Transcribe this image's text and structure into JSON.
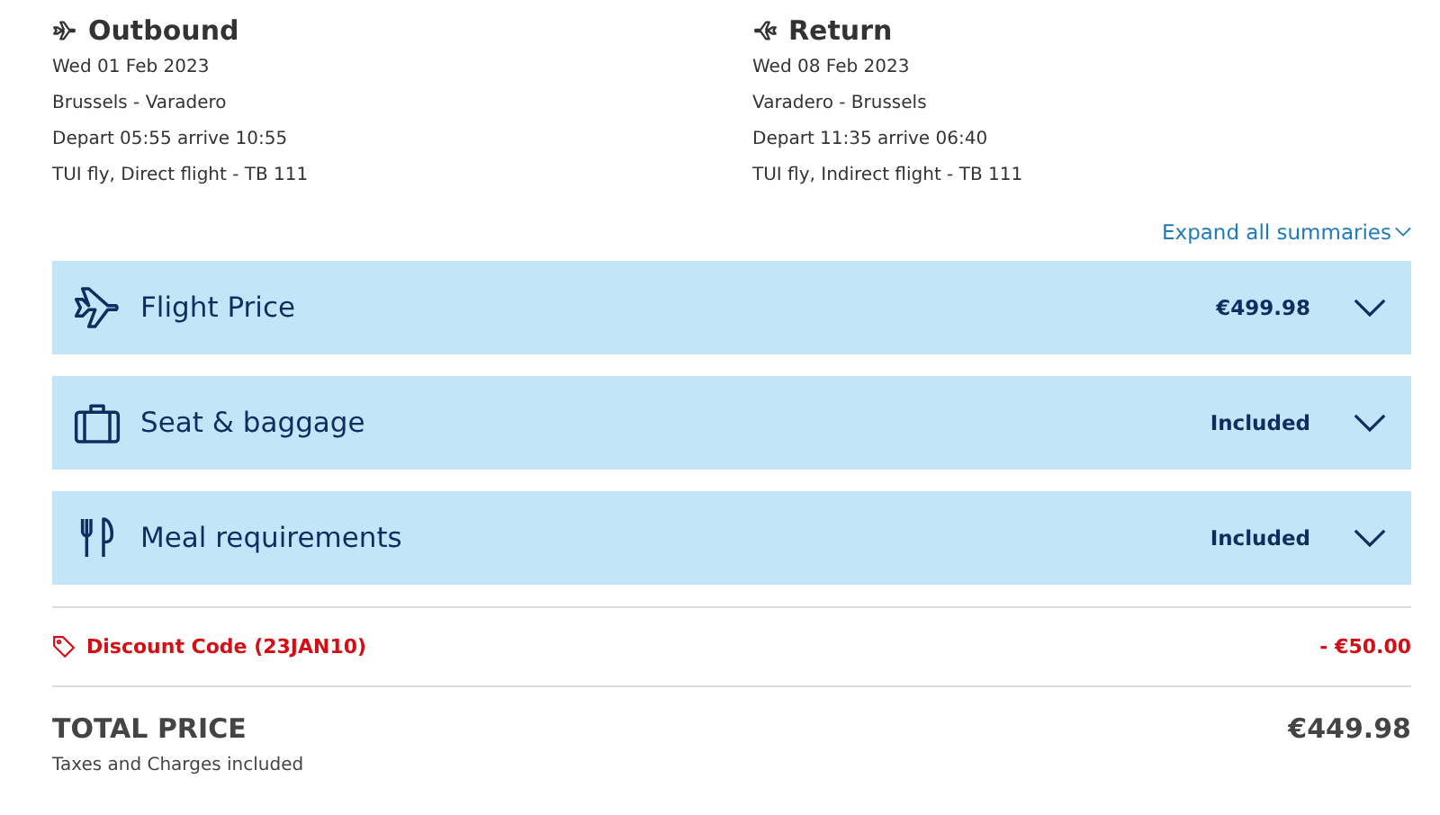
{
  "legs": [
    {
      "kind": "outbound",
      "title": "Outbound",
      "lines": [
        "Wed 01 Feb 2023",
        "Brussels - Varadero",
        "Depart 05:55 arrive 10:55",
        "TUI fly, Direct flight - TB 111"
      ]
    },
    {
      "kind": "return",
      "title": "Return",
      "lines": [
        "Wed 08 Feb 2023",
        "Varadero - Brussels",
        "Depart 11:35 arrive 06:40",
        "TUI fly, Indirect flight - TB 111"
      ]
    }
  ],
  "expand_all": "Expand all summaries",
  "sections": [
    {
      "kind": "plane",
      "label": "Flight Price",
      "value": "€499.98",
      "expanded": false
    },
    {
      "kind": "luggage",
      "label": "Seat & baggage",
      "value": "Included",
      "expanded": false
    },
    {
      "kind": "meal",
      "label": "Meal requirements",
      "value": "Included",
      "expanded": false
    }
  ],
  "discount": {
    "label": "Discount Code (23JAN10)",
    "amount": "- €50.00"
  },
  "total": {
    "label": "TOTAL PRICE",
    "amount": "€449.98",
    "note": "Taxes and Charges included"
  }
}
